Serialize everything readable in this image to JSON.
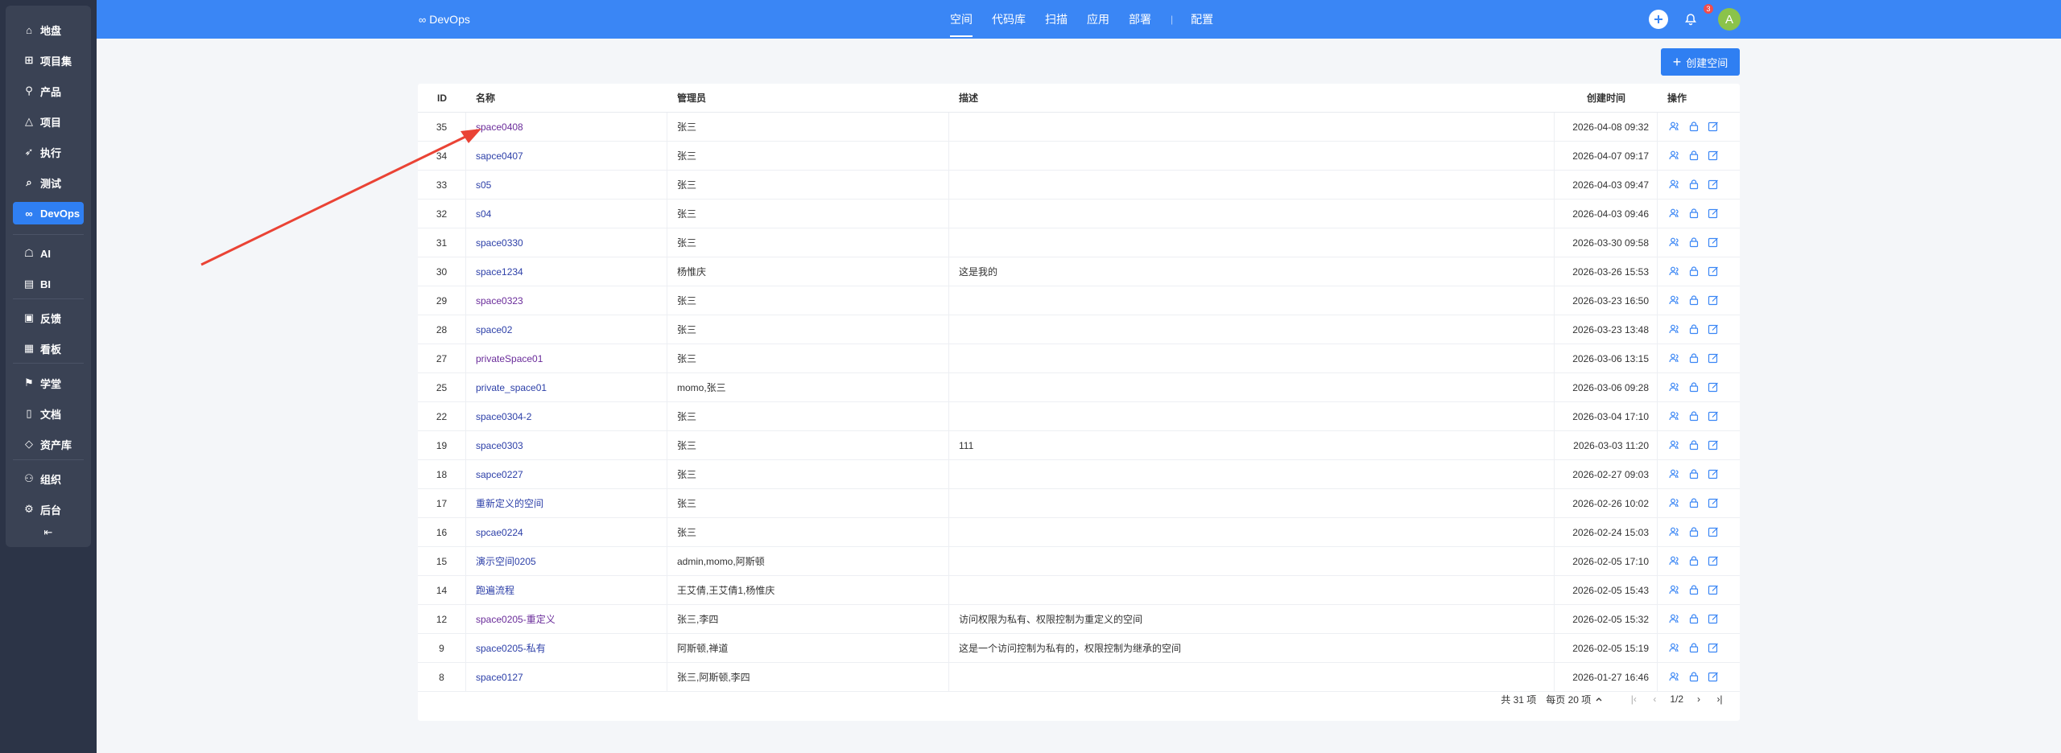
{
  "sidebar": {
    "items": [
      {
        "label": "地盘",
        "icon": "home-icon"
      },
      {
        "label": "项目集",
        "icon": "grid-icon"
      },
      {
        "label": "产品",
        "icon": "location-pin-icon"
      },
      {
        "label": "项目",
        "icon": "cone-icon"
      },
      {
        "label": "执行",
        "icon": "rocket-icon"
      },
      {
        "label": "测试",
        "icon": "search-check-icon"
      },
      {
        "label": "DevOps",
        "icon": "infinity-icon",
        "active": true
      },
      {
        "label": "AI",
        "icon": "robot-icon"
      },
      {
        "label": "BI",
        "icon": "chart-icon"
      },
      {
        "label": "反馈",
        "icon": "inbox-icon"
      },
      {
        "label": "看板",
        "icon": "board-icon"
      },
      {
        "label": "学堂",
        "icon": "graduation-icon"
      },
      {
        "label": "文档",
        "icon": "document-icon"
      },
      {
        "label": "资产库",
        "icon": "diamond-icon"
      },
      {
        "label": "组织",
        "icon": "people-icon"
      },
      {
        "label": "后台",
        "icon": "gear-icon"
      }
    ],
    "collapse_icon": "collapse-icon"
  },
  "header": {
    "brand": "DevOps",
    "nav": [
      {
        "label": "空间",
        "active": true
      },
      {
        "label": "代码库"
      },
      {
        "label": "扫描"
      },
      {
        "label": "应用"
      },
      {
        "label": "部署"
      },
      {
        "label": "配置"
      }
    ],
    "notification_count": "3",
    "avatar_letter": "A"
  },
  "create_button": "创建空间",
  "table": {
    "headers": [
      "ID",
      "名称",
      "管理员",
      "描述",
      "创建时间",
      "操作"
    ],
    "rows": [
      {
        "id": "35",
        "name": "space0408",
        "admin": "张三",
        "desc": "",
        "time": "2026-04-08 09:32",
        "visited": true
      },
      {
        "id": "34",
        "name": "sapce0407",
        "admin": "张三",
        "desc": "",
        "time": "2026-04-07 09:17"
      },
      {
        "id": "33",
        "name": "s05",
        "admin": "张三",
        "desc": "",
        "time": "2026-04-03 09:47"
      },
      {
        "id": "32",
        "name": "s04",
        "admin": "张三",
        "desc": "",
        "time": "2026-04-03 09:46"
      },
      {
        "id": "31",
        "name": "space0330",
        "admin": "张三",
        "desc": "",
        "time": "2026-03-30 09:58"
      },
      {
        "id": "30",
        "name": "space1234",
        "admin": "杨惟庆",
        "desc": "这是我的",
        "time": "2026-03-26 15:53"
      },
      {
        "id": "29",
        "name": "space0323",
        "admin": "张三",
        "desc": "",
        "time": "2026-03-23 16:50",
        "visited": true
      },
      {
        "id": "28",
        "name": "space02",
        "admin": "张三",
        "desc": "",
        "time": "2026-03-23 13:48"
      },
      {
        "id": "27",
        "name": "privateSpace01",
        "admin": "张三",
        "desc": "",
        "time": "2026-03-06 13:15",
        "visited": true
      },
      {
        "id": "25",
        "name": "private_space01",
        "admin": "momo,张三",
        "desc": "",
        "time": "2026-03-06 09:28"
      },
      {
        "id": "22",
        "name": "space0304-2",
        "admin": "张三",
        "desc": "",
        "time": "2026-03-04 17:10"
      },
      {
        "id": "19",
        "name": "space0303",
        "admin": "张三",
        "desc": "111",
        "time": "2026-03-03 11:20"
      },
      {
        "id": "18",
        "name": "sapce0227",
        "admin": "张三",
        "desc": "",
        "time": "2026-02-27 09:03"
      },
      {
        "id": "17",
        "name": "重新定义的空间",
        "admin": "张三",
        "desc": "",
        "time": "2026-02-26 10:02"
      },
      {
        "id": "16",
        "name": "spcae0224",
        "admin": "张三",
        "desc": "",
        "time": "2026-02-24 15:03"
      },
      {
        "id": "15",
        "name": "演示空间0205",
        "admin": "admin,momo,阿斯顿",
        "desc": "",
        "time": "2026-02-05 17:10"
      },
      {
        "id": "14",
        "name": "跑遍流程",
        "admin": "王艾倩,王艾倩1,杨惟庆",
        "desc": "",
        "time": "2026-02-05 15:43"
      },
      {
        "id": "12",
        "name": "space0205-重定义",
        "admin": "张三,李四",
        "desc": "访问权限为私有、权限控制为重定义的空间",
        "time": "2026-02-05 15:32",
        "visited": true
      },
      {
        "id": "9",
        "name": "space0205-私有",
        "admin": "阿斯顿,禅道",
        "desc": "这是一个访问控制为私有的，权限控制为继承的空间",
        "time": "2026-02-05 15:19"
      },
      {
        "id": "8",
        "name": "space0127",
        "admin": "张三,阿斯顿,李四",
        "desc": "",
        "time": "2026-01-27 16:46"
      }
    ],
    "row_actions": [
      "members-icon",
      "lock-icon",
      "edit-icon"
    ]
  },
  "pagination": {
    "total": "共 31 项",
    "page_size": "每页 20 项",
    "page": "1/2"
  },
  "colors": {
    "header": "#3a86f5",
    "sidebar": "#2c3447",
    "accent": "#2f7ff2",
    "annotation_arrow": "#ea4335"
  }
}
